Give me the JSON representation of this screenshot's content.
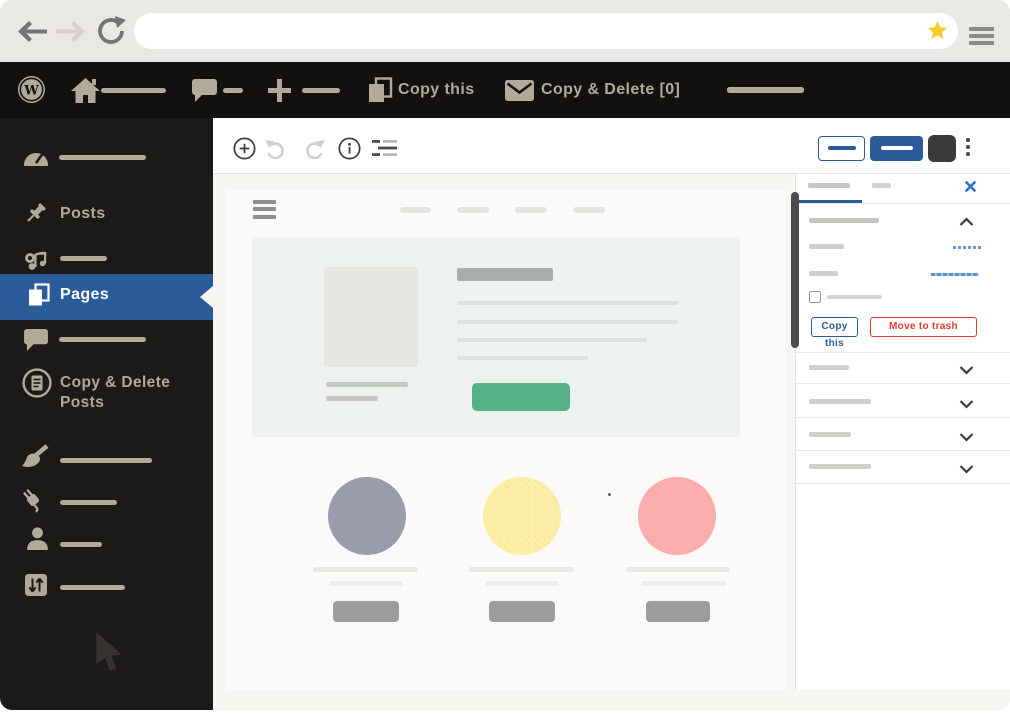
{
  "browser": {
    "url_value": "",
    "bookmark_star_color": "#f0cd2a"
  },
  "admin_bar": {
    "wp_logo_letter": "W",
    "copy_this_label": "Copy this",
    "copy_delete_label": "Copy & Delete [0]"
  },
  "sidebar": {
    "posts_label": "Posts",
    "pages_label": "Pages",
    "copy_delete_posts_label": "Copy & Delete Posts"
  },
  "panel": {
    "copy_this_button": "Copy this",
    "move_to_trash_button": "Move to trash"
  },
  "icons": {
    "back": "back-arrow-icon",
    "forward": "forward-arrow-icon",
    "refresh": "refresh-icon",
    "bookmark": "star-icon",
    "browser_menu": "menu-icon",
    "wordpress": "wordpress-logo-icon",
    "home": "home-icon",
    "comments": "comment-bubble-icon",
    "new": "plus-icon",
    "copy": "copy-pages-icon",
    "mail": "envelope-icon",
    "dashboard": "gauge-icon",
    "posts": "pushpin-icon",
    "media": "music-notes-icon",
    "pages": "pages-icon",
    "copy_delete": "document-circle-icon",
    "appearance": "paint-brush-icon",
    "plugins": "plug-icon",
    "users": "user-icon",
    "tools": "sliders-icon",
    "inserter": "plus-circle-icon",
    "undo": "undo-arrow-icon",
    "redo": "redo-arrow-icon",
    "info": "info-circle-icon",
    "outline": "list-view-icon",
    "more": "kebab-menu-icon",
    "close": "close-x-icon",
    "collapse": "chevron-up-icon",
    "expand": "chevron-down-icon",
    "cursor": "mouse-cursor-icon"
  },
  "colors": {
    "accent_blue": "#2b5c99",
    "link_blue": "#2e6fd0",
    "danger_red": "#e13b30",
    "green_button": "#56b189",
    "circle_purple": "#9b9bae",
    "circle_yellow": "#faeda5",
    "circle_pink": "#fbacac",
    "star_yellow": "#f0cd2a",
    "sidebar_tan": "#b2a999",
    "admin_bar_bg": "#131110",
    "sidebar_bg": "#1c1a19"
  }
}
